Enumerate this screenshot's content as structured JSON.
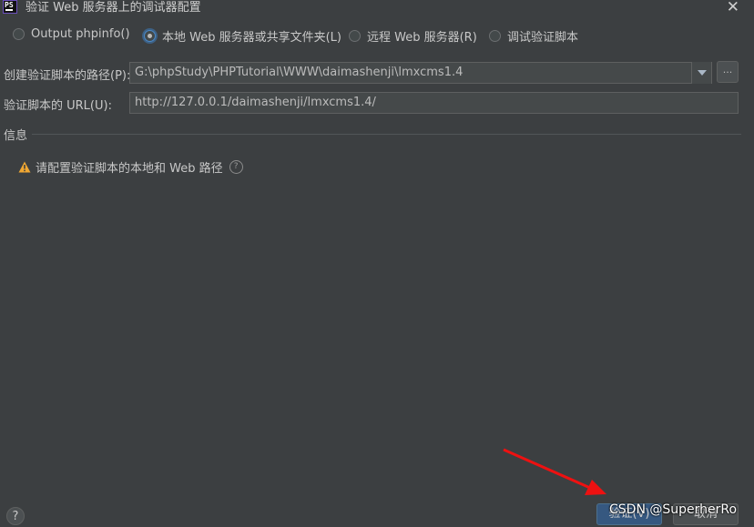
{
  "window": {
    "app_icon": "PS",
    "title": "验证 Web 服务器上的调试器配置",
    "close": "✕"
  },
  "radios": [
    {
      "label": "Output phpinfo()",
      "selected": false
    },
    {
      "label": "本地 Web 服务器或共享文件夹(L)",
      "selected": true
    },
    {
      "label": "远程 Web 服务器(R)",
      "selected": false
    },
    {
      "label": "调试验证脚本",
      "selected": false
    }
  ],
  "path": {
    "label": "创建验证脚本的路径(P):",
    "value": "G:\\phpStudy\\PHPTutorial\\WWW\\daimashenji\\lmxcms1.4",
    "browse_label": "..."
  },
  "url": {
    "label": "验证脚本的 URL(U):",
    "value": "http://127.0.0.1/daimashenji/lmxcms1.4/"
  },
  "info": {
    "title": "信息",
    "warning": "请配置验证脚本的本地和 Web 路径",
    "help_glyph": "?"
  },
  "footer": {
    "help_glyph": "?",
    "ok_label": "验证(V)",
    "cancel_label": "取消"
  },
  "watermark": "CSDN @SuperherRo",
  "colors": {
    "accent": "#365880",
    "warning": "#f0a732",
    "annotation_arrow": "#ee1111"
  }
}
